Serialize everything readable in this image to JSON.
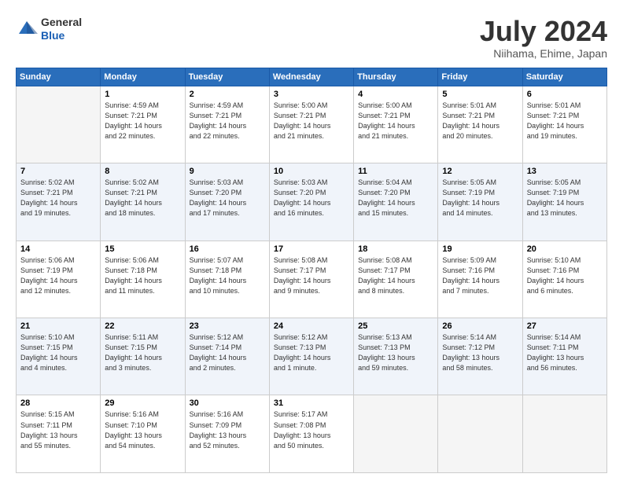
{
  "header": {
    "logo": {
      "line1": "General",
      "line2": "Blue"
    },
    "title": "July 2024",
    "location": "Niihama, Ehime, Japan"
  },
  "days_of_week": [
    "Sunday",
    "Monday",
    "Tuesday",
    "Wednesday",
    "Thursday",
    "Friday",
    "Saturday"
  ],
  "weeks": [
    [
      {
        "day": "",
        "info": ""
      },
      {
        "day": "1",
        "info": "Sunrise: 4:59 AM\nSunset: 7:21 PM\nDaylight: 14 hours\nand 22 minutes."
      },
      {
        "day": "2",
        "info": "Sunrise: 4:59 AM\nSunset: 7:21 PM\nDaylight: 14 hours\nand 22 minutes."
      },
      {
        "day": "3",
        "info": "Sunrise: 5:00 AM\nSunset: 7:21 PM\nDaylight: 14 hours\nand 21 minutes."
      },
      {
        "day": "4",
        "info": "Sunrise: 5:00 AM\nSunset: 7:21 PM\nDaylight: 14 hours\nand 21 minutes."
      },
      {
        "day": "5",
        "info": "Sunrise: 5:01 AM\nSunset: 7:21 PM\nDaylight: 14 hours\nand 20 minutes."
      },
      {
        "day": "6",
        "info": "Sunrise: 5:01 AM\nSunset: 7:21 PM\nDaylight: 14 hours\nand 19 minutes."
      }
    ],
    [
      {
        "day": "7",
        "info": "Sunrise: 5:02 AM\nSunset: 7:21 PM\nDaylight: 14 hours\nand 19 minutes."
      },
      {
        "day": "8",
        "info": "Sunrise: 5:02 AM\nSunset: 7:21 PM\nDaylight: 14 hours\nand 18 minutes."
      },
      {
        "day": "9",
        "info": "Sunrise: 5:03 AM\nSunset: 7:20 PM\nDaylight: 14 hours\nand 17 minutes."
      },
      {
        "day": "10",
        "info": "Sunrise: 5:03 AM\nSunset: 7:20 PM\nDaylight: 14 hours\nand 16 minutes."
      },
      {
        "day": "11",
        "info": "Sunrise: 5:04 AM\nSunset: 7:20 PM\nDaylight: 14 hours\nand 15 minutes."
      },
      {
        "day": "12",
        "info": "Sunrise: 5:05 AM\nSunset: 7:19 PM\nDaylight: 14 hours\nand 14 minutes."
      },
      {
        "day": "13",
        "info": "Sunrise: 5:05 AM\nSunset: 7:19 PM\nDaylight: 14 hours\nand 13 minutes."
      }
    ],
    [
      {
        "day": "14",
        "info": "Sunrise: 5:06 AM\nSunset: 7:19 PM\nDaylight: 14 hours\nand 12 minutes."
      },
      {
        "day": "15",
        "info": "Sunrise: 5:06 AM\nSunset: 7:18 PM\nDaylight: 14 hours\nand 11 minutes."
      },
      {
        "day": "16",
        "info": "Sunrise: 5:07 AM\nSunset: 7:18 PM\nDaylight: 14 hours\nand 10 minutes."
      },
      {
        "day": "17",
        "info": "Sunrise: 5:08 AM\nSunset: 7:17 PM\nDaylight: 14 hours\nand 9 minutes."
      },
      {
        "day": "18",
        "info": "Sunrise: 5:08 AM\nSunset: 7:17 PM\nDaylight: 14 hours\nand 8 minutes."
      },
      {
        "day": "19",
        "info": "Sunrise: 5:09 AM\nSunset: 7:16 PM\nDaylight: 14 hours\nand 7 minutes."
      },
      {
        "day": "20",
        "info": "Sunrise: 5:10 AM\nSunset: 7:16 PM\nDaylight: 14 hours\nand 6 minutes."
      }
    ],
    [
      {
        "day": "21",
        "info": "Sunrise: 5:10 AM\nSunset: 7:15 PM\nDaylight: 14 hours\nand 4 minutes."
      },
      {
        "day": "22",
        "info": "Sunrise: 5:11 AM\nSunset: 7:15 PM\nDaylight: 14 hours\nand 3 minutes."
      },
      {
        "day": "23",
        "info": "Sunrise: 5:12 AM\nSunset: 7:14 PM\nDaylight: 14 hours\nand 2 minutes."
      },
      {
        "day": "24",
        "info": "Sunrise: 5:12 AM\nSunset: 7:13 PM\nDaylight: 14 hours\nand 1 minute."
      },
      {
        "day": "25",
        "info": "Sunrise: 5:13 AM\nSunset: 7:13 PM\nDaylight: 13 hours\nand 59 minutes."
      },
      {
        "day": "26",
        "info": "Sunrise: 5:14 AM\nSunset: 7:12 PM\nDaylight: 13 hours\nand 58 minutes."
      },
      {
        "day": "27",
        "info": "Sunrise: 5:14 AM\nSunset: 7:11 PM\nDaylight: 13 hours\nand 56 minutes."
      }
    ],
    [
      {
        "day": "28",
        "info": "Sunrise: 5:15 AM\nSunset: 7:11 PM\nDaylight: 13 hours\nand 55 minutes."
      },
      {
        "day": "29",
        "info": "Sunrise: 5:16 AM\nSunset: 7:10 PM\nDaylight: 13 hours\nand 54 minutes."
      },
      {
        "day": "30",
        "info": "Sunrise: 5:16 AM\nSunset: 7:09 PM\nDaylight: 13 hours\nand 52 minutes."
      },
      {
        "day": "31",
        "info": "Sunrise: 5:17 AM\nSunset: 7:08 PM\nDaylight: 13 hours\nand 50 minutes."
      },
      {
        "day": "",
        "info": ""
      },
      {
        "day": "",
        "info": ""
      },
      {
        "day": "",
        "info": ""
      }
    ]
  ]
}
